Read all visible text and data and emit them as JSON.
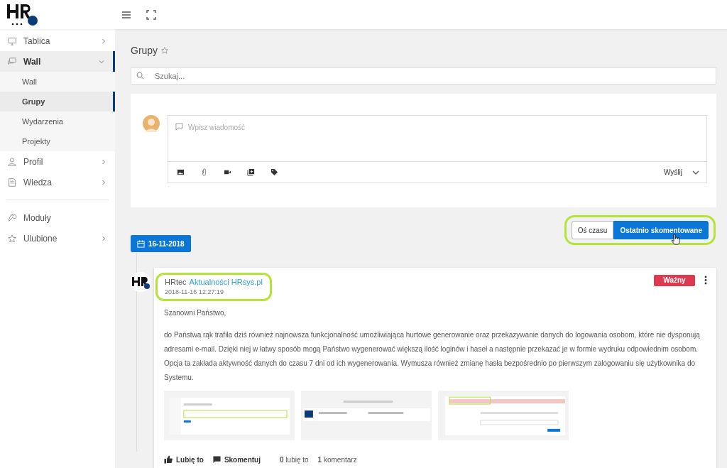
{
  "sidebar": {
    "items": [
      {
        "label": "Tablica",
        "has_arrow": true,
        "expanded": false,
        "selected": false
      },
      {
        "label": "Wall",
        "has_arrow": true,
        "expanded": true,
        "selected": true,
        "children": [
          {
            "label": "Wall",
            "selected": false
          },
          {
            "label": "Grupy",
            "selected": true
          },
          {
            "label": "Wydarzenia",
            "selected": false
          },
          {
            "label": "Projekty",
            "selected": false
          }
        ]
      },
      {
        "label": "Profil",
        "has_arrow": true,
        "expanded": false,
        "selected": false
      },
      {
        "label": "Wiedza",
        "has_arrow": true,
        "expanded": false,
        "selected": false,
        "divider_after": true
      },
      {
        "label": "Moduły",
        "has_arrow": false,
        "selected": false
      },
      {
        "label": "Ulubione",
        "has_arrow": true,
        "expanded": false,
        "selected": false
      }
    ]
  },
  "page": {
    "title": "Grupy",
    "search": {
      "placeholder": "Szukaj..."
    }
  },
  "composer": {
    "placeholder": "Wpisz wiadomość",
    "send": "Wyślij"
  },
  "view_toggle": [
    {
      "label": "Oś czasu",
      "selected": false
    },
    {
      "label": "Ostatnio skomentowane",
      "selected": true
    }
  ],
  "date_badge": "16-11-2018",
  "post": {
    "author": "HRtec",
    "group": "Aktualności HRsys.pl",
    "time": "2018-11-16 12:27:19",
    "tag": "Ważny",
    "greeting": "Szanowni Państwo,",
    "body": "do Państwa rąk trafiła dziś również najnowsza funkcjonalność umożliwiająca hurtowe generowanie oraz przekazywanie danych do logowania osobom, które nie dysponują adresami e-mail. Dzięki niej w łatwy sposób mogą Państwo wygenerować większą ilość loginów i haseł a następnie przekazać je w formie wydruku odpowiednim osobom. Opcja ta zakłada aktywność danych do czasu 7 dni od ich wygenerowania. Wymusza również zmianę hasła bezpośrednio po pierwszym zalogowaniu się użytkownika do Systemu.",
    "attachments": [
      {
        "kind": "app"
      },
      {
        "kind": "table"
      },
      {
        "kind": "form"
      }
    ],
    "like": "Lubię to",
    "comment": "Skomentuj",
    "likes": "**0** lubię to",
    "comments": "**1** komentarz"
  }
}
